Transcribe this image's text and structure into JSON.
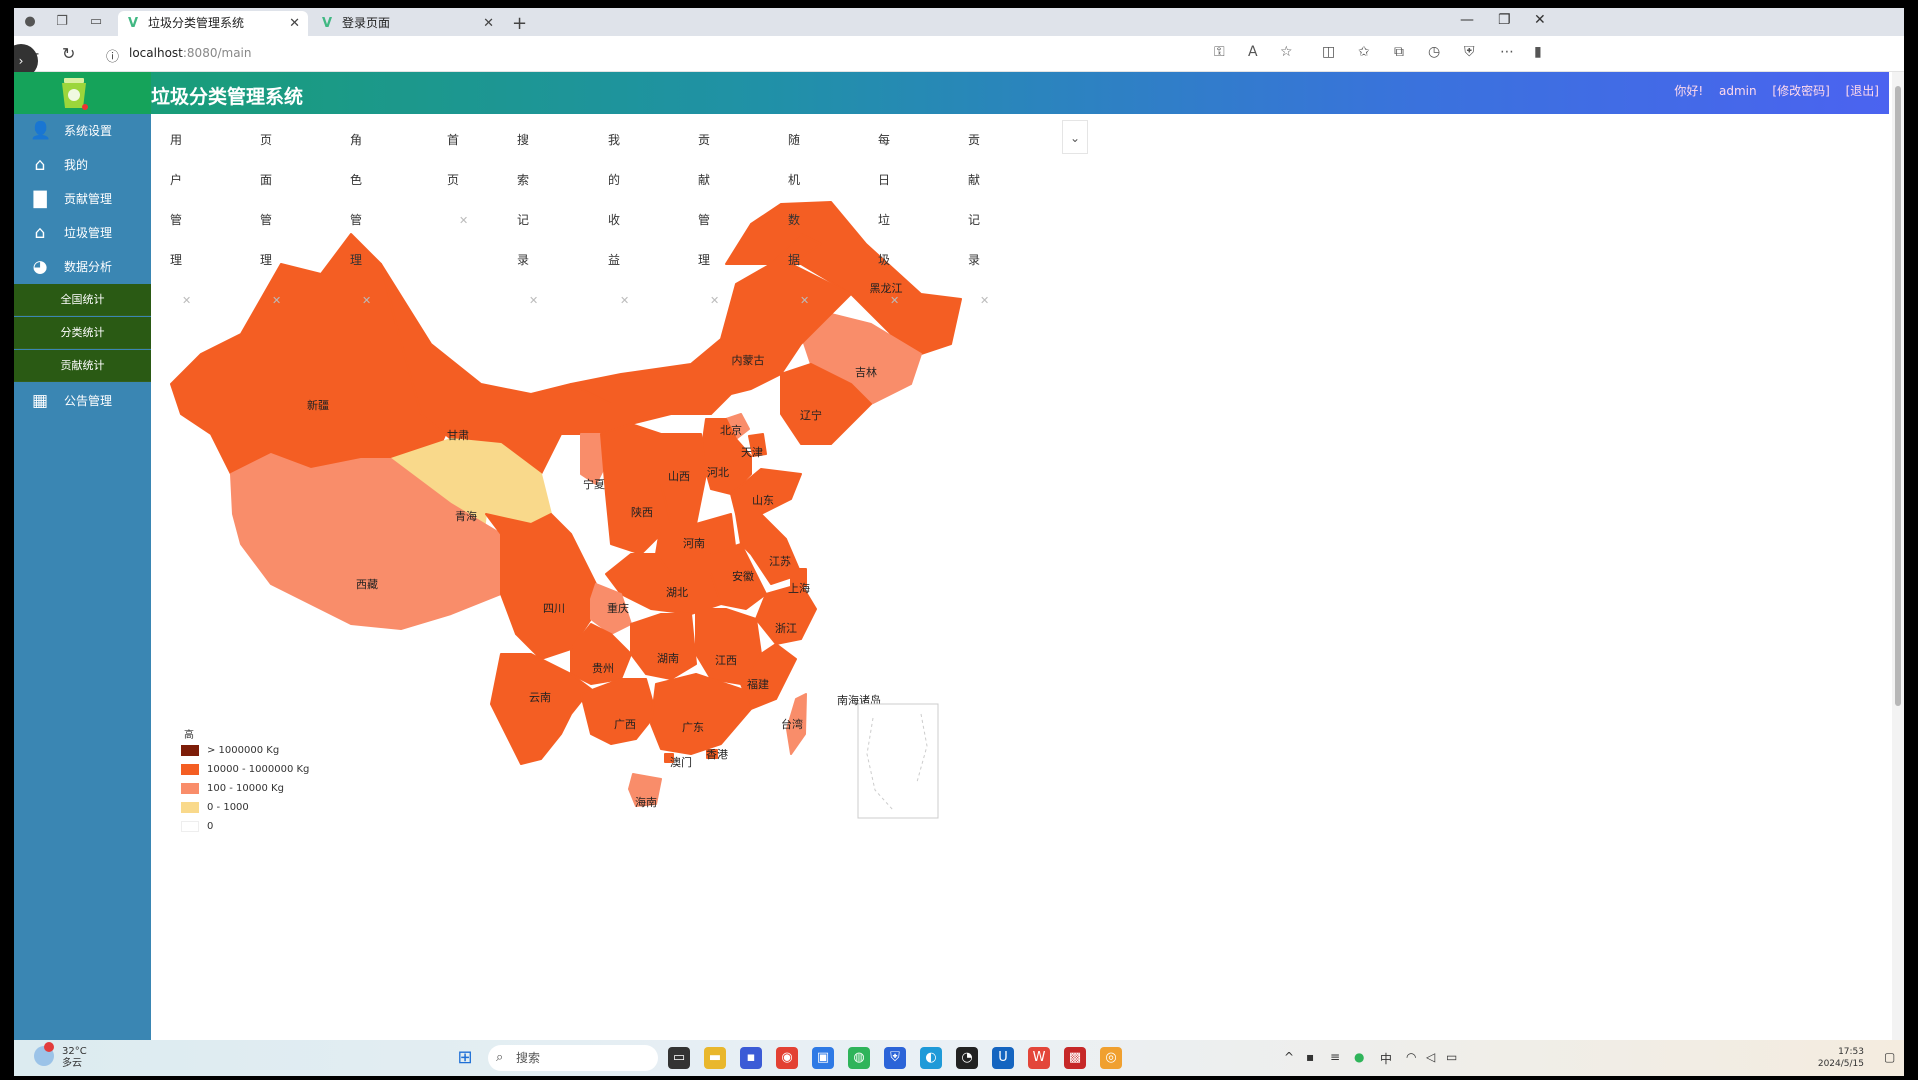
{
  "browser": {
    "tabs": [
      {
        "title": "垃圾分类管理系统",
        "active": true
      },
      {
        "title": "登录页面",
        "active": false
      }
    ],
    "url_host": "localhost",
    "url_path": ":8080/main"
  },
  "app": {
    "title": "垃圾分类管理系统",
    "greeting": "你好!",
    "username": "admin",
    "change_password": "[修改密码]",
    "logout": "[退出]"
  },
  "sidebar": {
    "items": [
      {
        "label": "系统设置",
        "icon": "user-icon"
      },
      {
        "label": "我的",
        "icon": "home-icon"
      },
      {
        "label": "贡献管理",
        "icon": "bar-chart-icon"
      },
      {
        "label": "垃圾管理",
        "icon": "building-icon"
      },
      {
        "label": "数据分析",
        "icon": "pie-chart-icon"
      },
      {
        "label": "公告管理",
        "icon": "grid-icon"
      }
    ],
    "subitems": [
      {
        "label": "全国统计"
      },
      {
        "label": "分类统计"
      },
      {
        "label": "贡献统计"
      }
    ]
  },
  "content_tabs": [
    {
      "label": "用户管理"
    },
    {
      "label": "页面管理"
    },
    {
      "label": "角色管理"
    },
    {
      "label": "首页"
    },
    {
      "label": "搜索记录"
    },
    {
      "label": "我的收益"
    },
    {
      "label": "贡献管理"
    },
    {
      "label": "随机数据"
    },
    {
      "label": "每日垃圾"
    },
    {
      "label": "贡献记录"
    }
  ],
  "map": {
    "legend_title": "高",
    "legend": [
      {
        "label": "> 1000000 Kg",
        "color": "#7d1d08"
      },
      {
        "label": "10000 - 1000000 Kg",
        "color": "#f45e23"
      },
      {
        "label": "100 - 10000 Kg",
        "color": "#f98d6a"
      },
      {
        "label": "0 - 1000",
        "color": "#f9d98b"
      },
      {
        "label": "0",
        "color": "#ffffff"
      }
    ],
    "provinces": [
      {
        "name": "黑龙江",
        "level": "10000 - 1000000 Kg"
      },
      {
        "name": "吉林",
        "level": "100 - 10000 Kg"
      },
      {
        "name": "辽宁",
        "level": "10000 - 1000000 Kg"
      },
      {
        "name": "内蒙古",
        "level": "10000 - 1000000 Kg"
      },
      {
        "name": "北京",
        "level": "100 - 10000 Kg"
      },
      {
        "name": "天津",
        "level": "10000 - 1000000 Kg"
      },
      {
        "name": "河北",
        "level": "10000 - 1000000 Kg"
      },
      {
        "name": "山西",
        "level": "10000 - 1000000 Kg"
      },
      {
        "name": "山东",
        "level": "10000 - 1000000 Kg"
      },
      {
        "name": "新疆",
        "level": "10000 - 1000000 Kg"
      },
      {
        "name": "甘肃",
        "level": "10000 - 1000000 Kg"
      },
      {
        "name": "宁夏",
        "level": "100 - 10000 Kg"
      },
      {
        "name": "陕西",
        "level": "10000 - 1000000 Kg"
      },
      {
        "name": "青海",
        "level": "0 - 1000"
      },
      {
        "name": "西藏",
        "level": "100 - 10000 Kg"
      },
      {
        "name": "河南",
        "level": "10000 - 1000000 Kg"
      },
      {
        "name": "江苏",
        "level": "10000 - 1000000 Kg"
      },
      {
        "name": "安徽",
        "level": "10000 - 1000000 Kg"
      },
      {
        "name": "上海",
        "level": "10000 - 1000000 Kg"
      },
      {
        "name": "湖北",
        "level": "10000 - 1000000 Kg"
      },
      {
        "name": "四川",
        "level": "10000 - 1000000 Kg"
      },
      {
        "name": "重庆",
        "level": "100 - 10000 Kg"
      },
      {
        "name": "浙江",
        "level": "10000 - 1000000 Kg"
      },
      {
        "name": "湖南",
        "level": "10000 - 1000000 Kg"
      },
      {
        "name": "江西",
        "level": "10000 - 1000000 Kg"
      },
      {
        "name": "贵州",
        "level": "10000 - 1000000 Kg"
      },
      {
        "name": "福建",
        "level": "10000 - 1000000 Kg"
      },
      {
        "name": "云南",
        "level": "10000 - 1000000 Kg"
      },
      {
        "name": "广西",
        "level": "10000 - 1000000 Kg"
      },
      {
        "name": "广东",
        "level": "10000 - 1000000 Kg"
      },
      {
        "name": "台湾",
        "level": "100 - 10000 Kg"
      },
      {
        "name": "澳门",
        "level": "10000 - 1000000 Kg"
      },
      {
        "name": "香港",
        "level": "10000 - 1000000 Kg"
      },
      {
        "name": "海南",
        "level": "100 - 10000 Kg"
      },
      {
        "name": "南海诸岛",
        "level": "0"
      }
    ]
  },
  "taskbar": {
    "weather_temp": "32°C",
    "weather_desc": "多云",
    "search_placeholder": "搜索",
    "time": "17:53",
    "date": "2024/5/15",
    "ime": "中"
  }
}
